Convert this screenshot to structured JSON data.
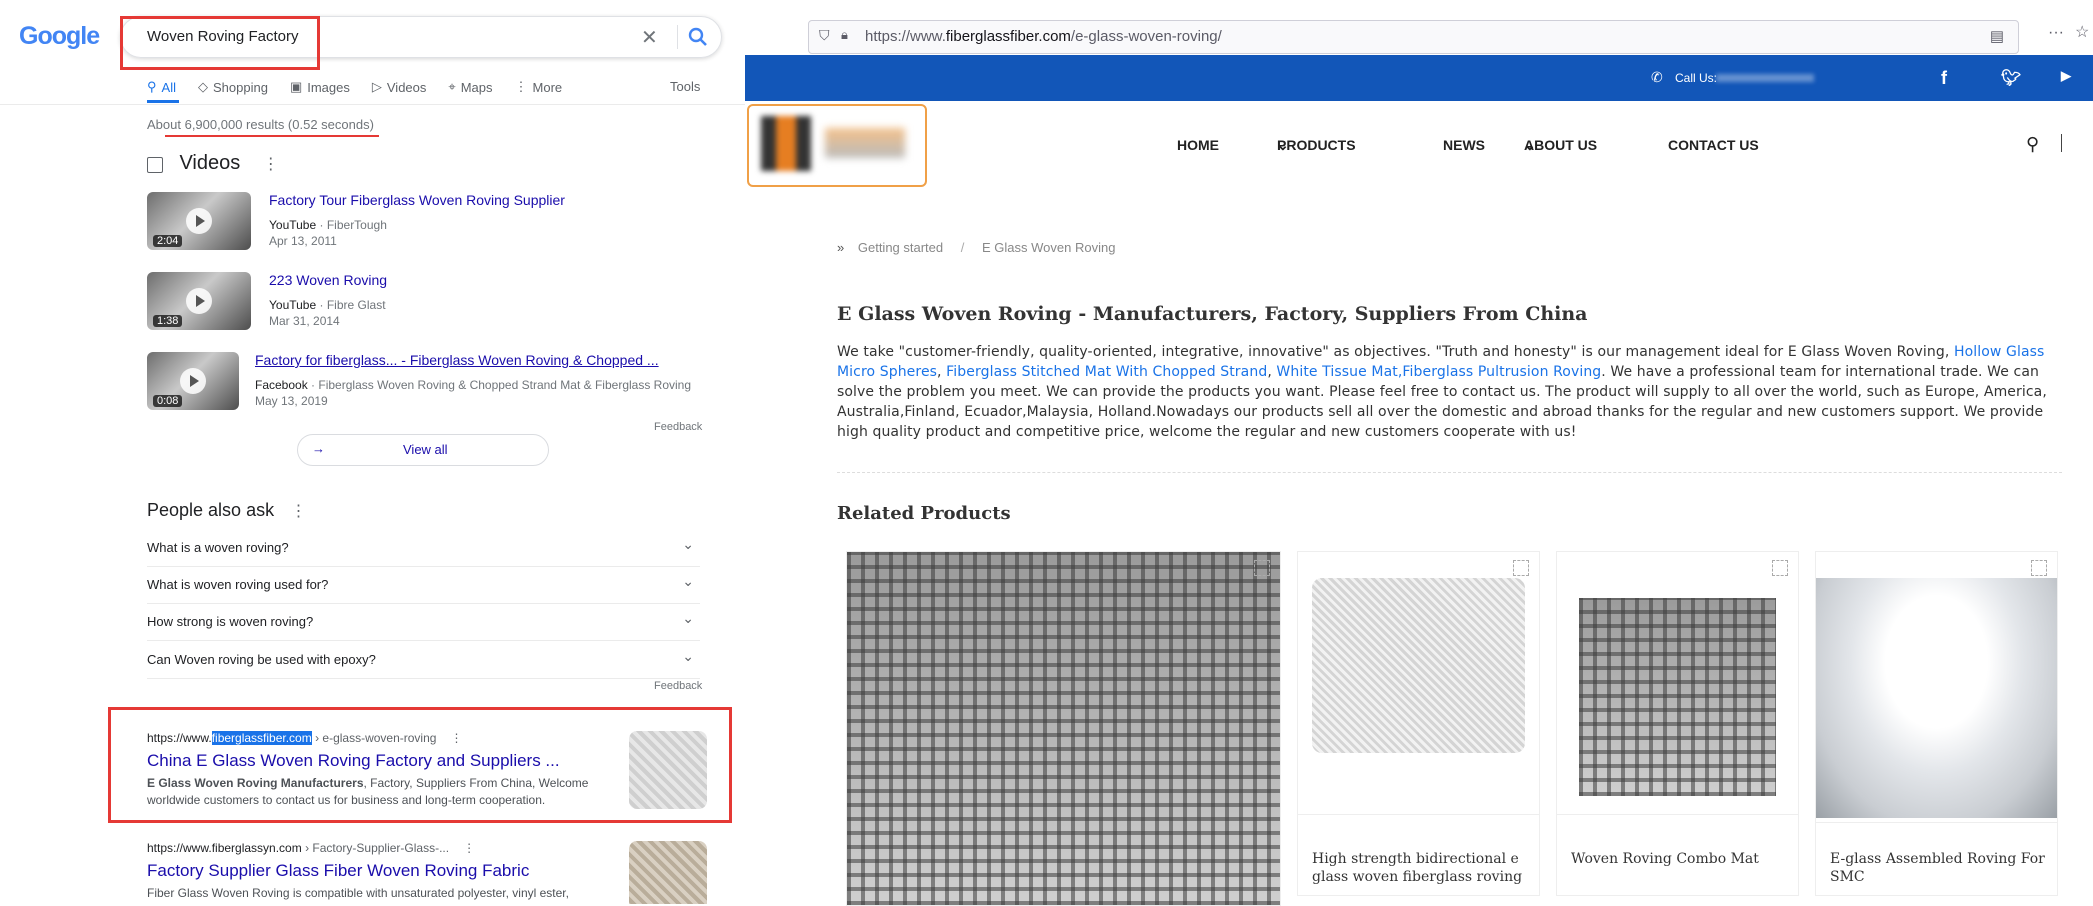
{
  "google": {
    "logo": "Google",
    "query": "Woven Roving Factory",
    "tabs": [
      "All",
      "Shopping",
      "Images",
      "Videos",
      "Maps",
      "More"
    ],
    "tools": "Tools",
    "stats": "About 6,900,000 results (0.52 seconds)",
    "videos_title": "Videos",
    "videos": [
      {
        "title": "Factory Tour Fiberglass Woven Roving Supplier",
        "source": "YouTube",
        "channel": "FiberTough",
        "date": "Apr 13, 2011",
        "duration": "2:04"
      },
      {
        "title": "223 Woven Roving",
        "source": "YouTube",
        "channel": "Fibre Glast",
        "date": "Mar 31, 2014",
        "duration": "1:38"
      },
      {
        "title": "Factory for fiberglass... - Fiberglass Woven Roving & Chopped ...",
        "source": "Facebook",
        "channel": "Fiberglass Woven Roving & Chopped Strand Mat & Fiberglass Roving",
        "date": "May 13, 2019",
        "duration": "0:08"
      }
    ],
    "feedback": "Feedback",
    "view_all": "View all",
    "paa_title": "People also ask",
    "paa": [
      "What is a woven roving?",
      "What is woven roving used for?",
      "How strong is woven roving?",
      "Can Woven roving be used with epoxy?"
    ],
    "results": [
      {
        "url_prefix": "https://www.",
        "url_highlight": "fiberglassfiber.com",
        "url_crumb": " › e-glass-woven-roving",
        "title": "China E Glass Woven Roving Factory and Suppliers ...",
        "snippet_bold": "E Glass Woven Roving Manufacturers",
        "snippet_rest": ", Factory, Suppliers From China, Welcome worldwide customers to contact us for business and long-term cooperation."
      },
      {
        "url_prefix": "https://www.fiberglassyn.com",
        "url_highlight": "",
        "url_crumb": " › Factory-Supplier-Glass-...",
        "title": "Factory Supplier Glass Fiber Woven Roving Fabric",
        "snippet_bold": "",
        "snippet_rest": "Fiber Glass Woven Roving is compatible with unsaturated polyester, vinyl ester,"
      }
    ]
  },
  "browser": {
    "url_prefix": "https://www.",
    "url_domain": "fiberglassfiber.com",
    "url_path": "/e-glass-woven-roving/",
    "call_us": "Call Us:",
    "nav": [
      "HOME",
      "PRODUCTS",
      "NEWS",
      "ABOUT US",
      "CONTACT US"
    ],
    "breadcrumb": [
      "Getting started",
      "E Glass Woven Roving"
    ],
    "title": "E Glass Woven Roving - Manufacturers, Factory, Suppliers From China",
    "body_a": "We take \"customer-friendly, quality-oriented, integrative, innovative\" as objectives. \"Truth and honesty\" is our management ideal for E Glass Woven Roving, ",
    "link1": "Hollow Glass Micro Spheres",
    "sep1": ", ",
    "link2": "Fiberglass Stitched Mat With Chopped Strand",
    "sep2": ", ",
    "link3": "White Tissue Mat,Fiberglass Pultrusion Roving",
    "body_b": ". We have a professional team for international trade. We can solve the problem you meet. We can provide the products you want. Please feel free to contact us. The product will supply to all over the world, such as Europe, America, Australia,Finland, Ecuador,Malaysia, Holland.Nowadays our products sell all over the domestic and abroad thanks for the regular and new customers support. We provide high quality product and competitive price, welcome the regular and new customers cooperate with us!",
    "related_title": "Related Products",
    "products": [
      {
        "caption": ""
      },
      {
        "caption": "High strength bidirectional e glass woven fiberglass roving"
      },
      {
        "caption": "Woven Roving Combo Mat"
      },
      {
        "caption": "E-glass Assembled Roving For SMC"
      }
    ]
  },
  "colors": {
    "google_blue": "#1a73e8",
    "link": "#1a0dab",
    "highlight_red": "#e53935",
    "site_blue": "#1256b8",
    "logo_orange": "#f0a047"
  }
}
